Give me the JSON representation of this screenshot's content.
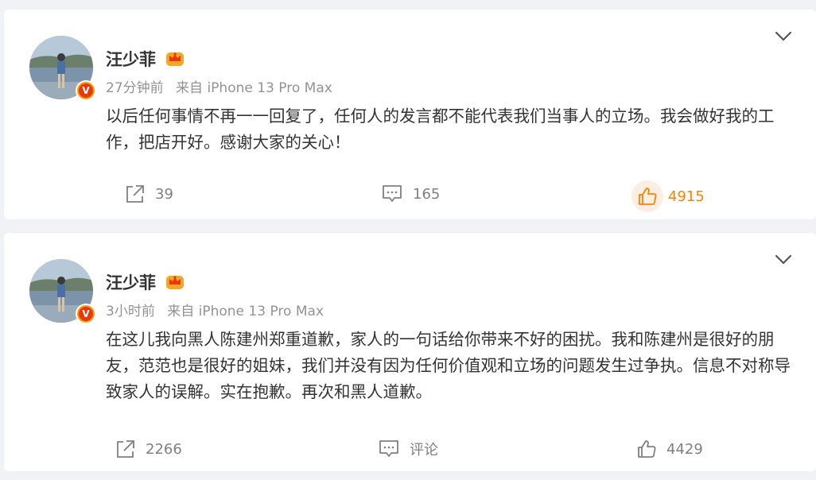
{
  "posts": [
    {
      "author": "汪少菲",
      "time": "27分钟前",
      "source": "来自 iPhone 13 Pro Max",
      "text": "以后任何事情不再一一回复了，任何人的发言都不能代表我们当事人的立场。我会做好我的工作，把店开好。感谢大家的关心！",
      "reposts": "39",
      "comments": "165",
      "likes": "4915",
      "liked": true
    },
    {
      "author": "汪少菲",
      "time": "3小时前",
      "source": "来自 iPhone 13 Pro Max",
      "text": "在这儿我向黑人陈建州郑重道歉，家人的一句话给你带来不好的困扰。我和陈建州是很好的朋友，范范也是很好的姐妹，我们并没有因为任何价值观和立场的问题发生过争执。信息不对称导致家人的误解。实在抱歉。再次和黑人道歉。",
      "reposts": "2266",
      "comments": "评论",
      "likes": "4429",
      "liked": false
    }
  ],
  "badge_letter": "V",
  "icons": {
    "repost": "repost-icon",
    "comment": "comment-icon",
    "like": "thumbs-up-icon",
    "more": "chevron-down-icon",
    "member": "crown-icon"
  },
  "colors": {
    "accent": "#ff8200",
    "badge": "#f7a100",
    "muted": "#939393"
  }
}
